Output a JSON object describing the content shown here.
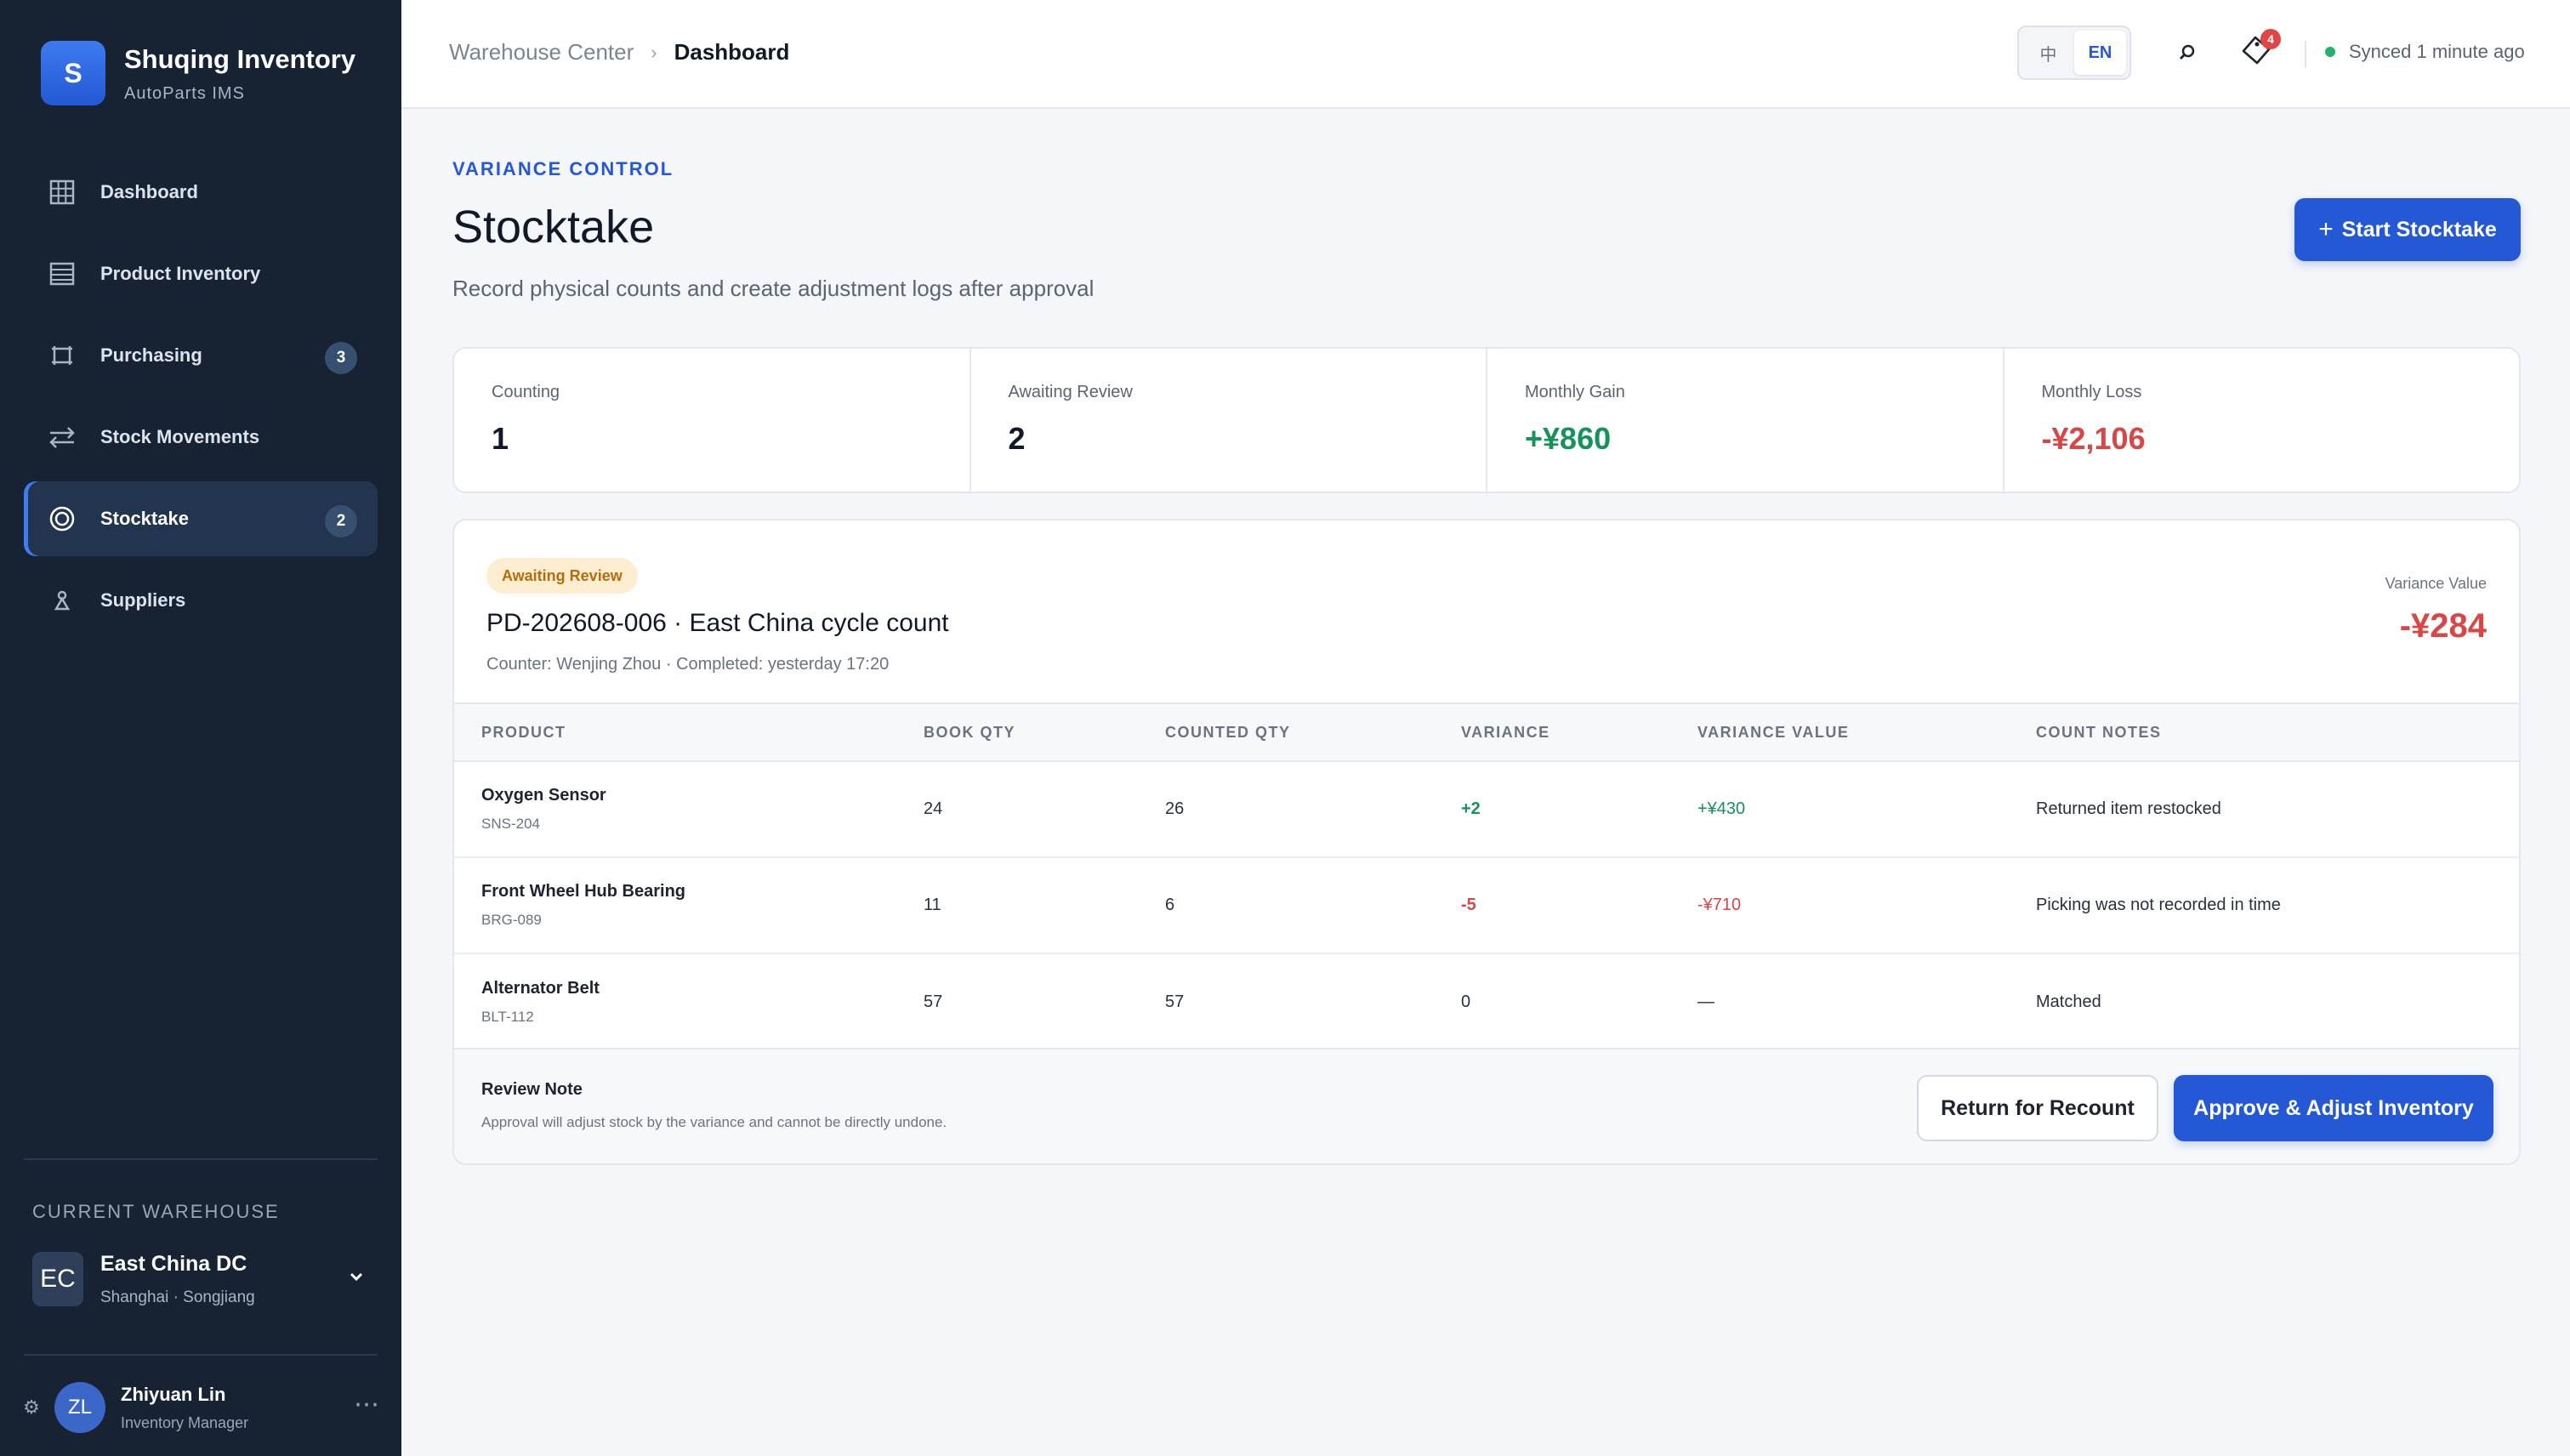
{
  "brand": {
    "logo_letter": "S",
    "title": "Shuqing Inventory",
    "subtitle": "AutoParts IMS"
  },
  "nav": {
    "items": [
      {
        "label": "Dashboard",
        "icon": "grid-icon"
      },
      {
        "label": "Product Inventory",
        "icon": "table-icon"
      },
      {
        "label": "Purchasing",
        "icon": "cart-icon",
        "badge": "3"
      },
      {
        "label": "Stock Movements",
        "icon": "transfer-icon"
      },
      {
        "label": "Stocktake",
        "icon": "target-icon",
        "badge": "2",
        "active": true
      },
      {
        "label": "Suppliers",
        "icon": "supplier-icon"
      }
    ]
  },
  "warehouse": {
    "label": "CURRENT WAREHOUSE",
    "avatar": "EC",
    "name": "East China DC",
    "location": "Shanghai · Songjiang"
  },
  "user": {
    "avatar": "ZL",
    "name": "Zhiyuan Lin",
    "role": "Inventory Manager",
    "more": "⋯"
  },
  "header": {
    "breadcrumb_parent": "Warehouse Center",
    "breadcrumb_sep": "›",
    "breadcrumb_current": "Dashboard",
    "lang_zh": "中",
    "lang_en": "EN",
    "notification_count": "4",
    "sync_status": "Synced 1 minute ago"
  },
  "page": {
    "eyebrow": "VARIANCE CONTROL",
    "title": "Stocktake",
    "description": "Record physical counts and create adjustment logs after approval",
    "primary_button_icon": "+",
    "primary_button": "Start Stocktake"
  },
  "stats": [
    {
      "label": "Counting",
      "value": "1"
    },
    {
      "label": "Awaiting Review",
      "value": "2"
    },
    {
      "label": "Monthly Gain",
      "value": "+¥860"
    },
    {
      "label": "Monthly Loss",
      "value": "-¥2,106"
    }
  ],
  "stocktake": {
    "status": "Awaiting Review",
    "title": "PD-202608-006 · East China cycle count",
    "meta": "Counter: Wenjing Zhou · Completed: yesterday 17:20",
    "variance_label": "Variance Value",
    "variance_value": "-¥284",
    "columns": [
      "PRODUCT",
      "BOOK QTY",
      "COUNTED QTY",
      "VARIANCE",
      "VARIANCE VALUE",
      "COUNT NOTES"
    ],
    "rows": [
      {
        "name": "Oxygen Sensor",
        "sku": "SNS-204",
        "book": "24",
        "counted": "26",
        "variance": "+2",
        "value": "+¥430",
        "notes": "Returned item restocked"
      },
      {
        "name": "Front Wheel Hub Bearing",
        "sku": "BRG-089",
        "book": "11",
        "counted": "6",
        "variance": "-5",
        "value": "-¥710",
        "notes": "Picking was not recorded in time"
      },
      {
        "name": "Alternator Belt",
        "sku": "BLT-112",
        "book": "57",
        "counted": "57",
        "variance": "0",
        "value": "—",
        "notes": "Matched"
      }
    ],
    "review_note_title": "Review Note",
    "review_note_text": "Approval will adjust stock by the variance and cannot be directly undone.",
    "recount_button": "Return for Recount",
    "approve_button": "Approve & Adjust Inventory"
  },
  "colors": {
    "accent": "#2458d4",
    "sidebar": "#172233",
    "gain": "#16935a",
    "loss": "#d94646",
    "pending": "#b86b09"
  }
}
